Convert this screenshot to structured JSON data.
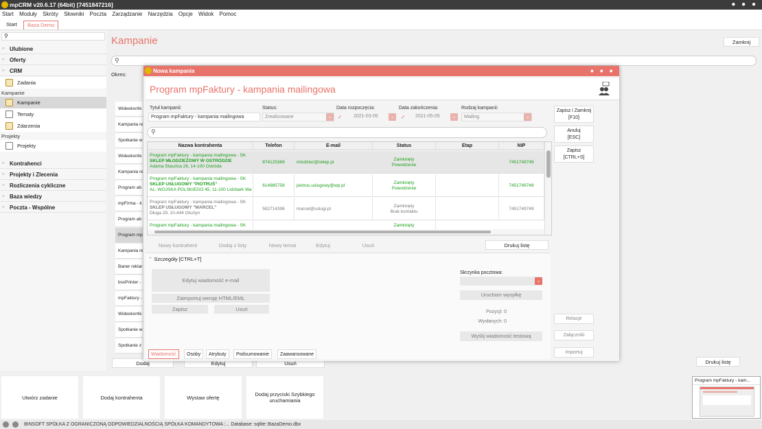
{
  "window_title": "mpCRM v20.6.17 (64bit) [7451847216]",
  "menu": [
    "Start",
    "Moduły",
    "Skróty",
    "Słowniki",
    "Poczta",
    "Zarządzanie",
    "Narzędzia",
    "Opcje",
    "Widok",
    "Pomoc"
  ],
  "tabs": [
    "Start",
    "Baza Demo"
  ],
  "sidebar": {
    "groups": [
      "Ulubione",
      "Oferty",
      "CRM",
      "Kontrahenci",
      "Projekty i Zlecenia",
      "Rozliczenia cykliczne",
      "Baza wiedzy",
      "Poczta - Wspólne"
    ],
    "crm_items": [
      "Zadania"
    ],
    "kampanie_header": "Kampanie",
    "kampanie_items": [
      "Kampanie",
      "Tematy",
      "Zdarzenia"
    ],
    "projekty_header": "Projekty",
    "projekty_items": [
      "Projekty"
    ]
  },
  "main": {
    "title": "Kampanie",
    "close": "Zamknij",
    "okres": "Okres:",
    "list": [
      "Wideokonfe",
      "Kampania re",
      "Spotkanie w",
      "Wideokonfe",
      "Kampania re",
      "Program ab",
      "mpFirma - k",
      "Program ab",
      "Program mp",
      "Kampania re",
      "Baner reklar",
      "bsxPrinter -",
      "mpFaktury -",
      "Wideokonfe",
      "Spotkanie w",
      "Spotkanie z"
    ],
    "bottom": {
      "dodaj": "Dodaj",
      "edytuj": "Edytuj",
      "usun": "Usuń",
      "drukuj": "Drukuj listę"
    }
  },
  "tiles": [
    "Utwórz zadanie",
    "Dodaj kontrahenta",
    "Wystaw ofertę",
    "Dodaj przyciski Szybkiego uruchamiania"
  ],
  "preview_title": "Program mpFaktury - kam...",
  "status": "BINSOFT SPÓŁKA Z OGRANICZONĄ ODPOWIEDZIALNOŚCIĄ SPÓŁKA KOMANDYTOWA :... Database: sqlite::BazaDemo.dbx",
  "dialog": {
    "title": "Nowa kampania",
    "header": "Program mpFaktury - kampania mailingowa",
    "fields": {
      "tytul_label": "Tytuł kampanii:",
      "tytul_value": "Program mpFaktury - kampania mailingowa",
      "status_label": "Status:",
      "status_value": "Zrealizowane",
      "start_label": "Data rozpoczęcia:",
      "start_value": "2021-03-05",
      "end_label": "Data zakończenia:",
      "end_value": "2021-05-05",
      "rodzaj_label": "Rodzaj kampanii:",
      "rodzaj_value": "Mailing"
    },
    "grid_headers": [
      "Nazwa kontrahenta",
      "Telefon",
      "E-mail",
      "Status",
      "Etap",
      "NIP"
    ],
    "rows": [
      {
        "campaign": "Program mpFaktury - kampania mailingowa - SK",
        "name": "SKLEP MŁODZIEŻOWY W OSTRÓDZIE",
        "addr": "Adama Staszica 26, 14-100 Ostróda",
        "phone": "874125369",
        "email": "mlodziez@sklep.pl",
        "status1": "Zamknięty",
        "status2": "Powodzenie",
        "nip": "7451749749",
        "color": "green"
      },
      {
        "campaign": "Program mpFaktury - kampania mailingowa - SK",
        "name": "SKLEP USŁUGOWY \"PIOTRUŚ\"",
        "addr": "AL. WOJSKA POLSKIEGO 45, 11-100 Lidzbark Wa",
        "phone": "614985758",
        "email": "piotrus.uslugowy@wp.pl",
        "status1": "Zamknięty",
        "status2": "Powodzenie",
        "nip": "7451749749",
        "color": "green"
      },
      {
        "campaign": "Program mpFaktury - kampania mailingowa - SK",
        "name": "SKLEP USŁUGOWY \"MARCEL\"",
        "addr": "Długa 29, 10-444 Olsztyn",
        "phone": "582714396",
        "email": "marcel@uslugi.pl",
        "status1": "Zamknięty",
        "status2": "Brak kontaktu",
        "nip": "7451749749",
        "color": "gray"
      },
      {
        "campaign": "Program mpFaktury - kampania mailingowa - SK",
        "name": "",
        "addr": "",
        "phone": "",
        "email": "",
        "status1": "Zamknięty",
        "status2": "",
        "nip": "",
        "color": "green"
      }
    ],
    "grid_buttons": [
      "Nowy kontrahent",
      "Dodaj z listy",
      "Nowy temat",
      "Edytuj",
      "Usuń",
      "Drukuj listę"
    ],
    "side_buttons": [
      {
        "l1": "Zapisz i Zamknij",
        "l2": "[F10]"
      },
      {
        "l1": "Anuluj",
        "l2": "[ESC]"
      },
      {
        "l1": "Zapisz",
        "l2": "[CTRL+S]"
      }
    ],
    "side_lower": [
      "Relacje",
      "Załączniki",
      "Importuj"
    ],
    "details": {
      "title": "Szczegóły [CTRL+T]",
      "edit_msg": "Edytuj wiadomość e-mail",
      "import_html": "Zaimportuj wersję HTML/EML",
      "save": "Zapisz",
      "remove": "Usuń",
      "mailbox_label": "Skrzynka pocztowa:",
      "run": "Uruchom wysyłkę",
      "pozycji": "Pozycji: 0",
      "wyslanych": "Wysłanych: 0",
      "test": "Wyślij wiadomość testową"
    },
    "bottom_tabs": [
      "Wiadomość",
      "Osoby",
      "Atrybuty",
      "Podsumowanie",
      "Zaawansowane"
    ]
  }
}
